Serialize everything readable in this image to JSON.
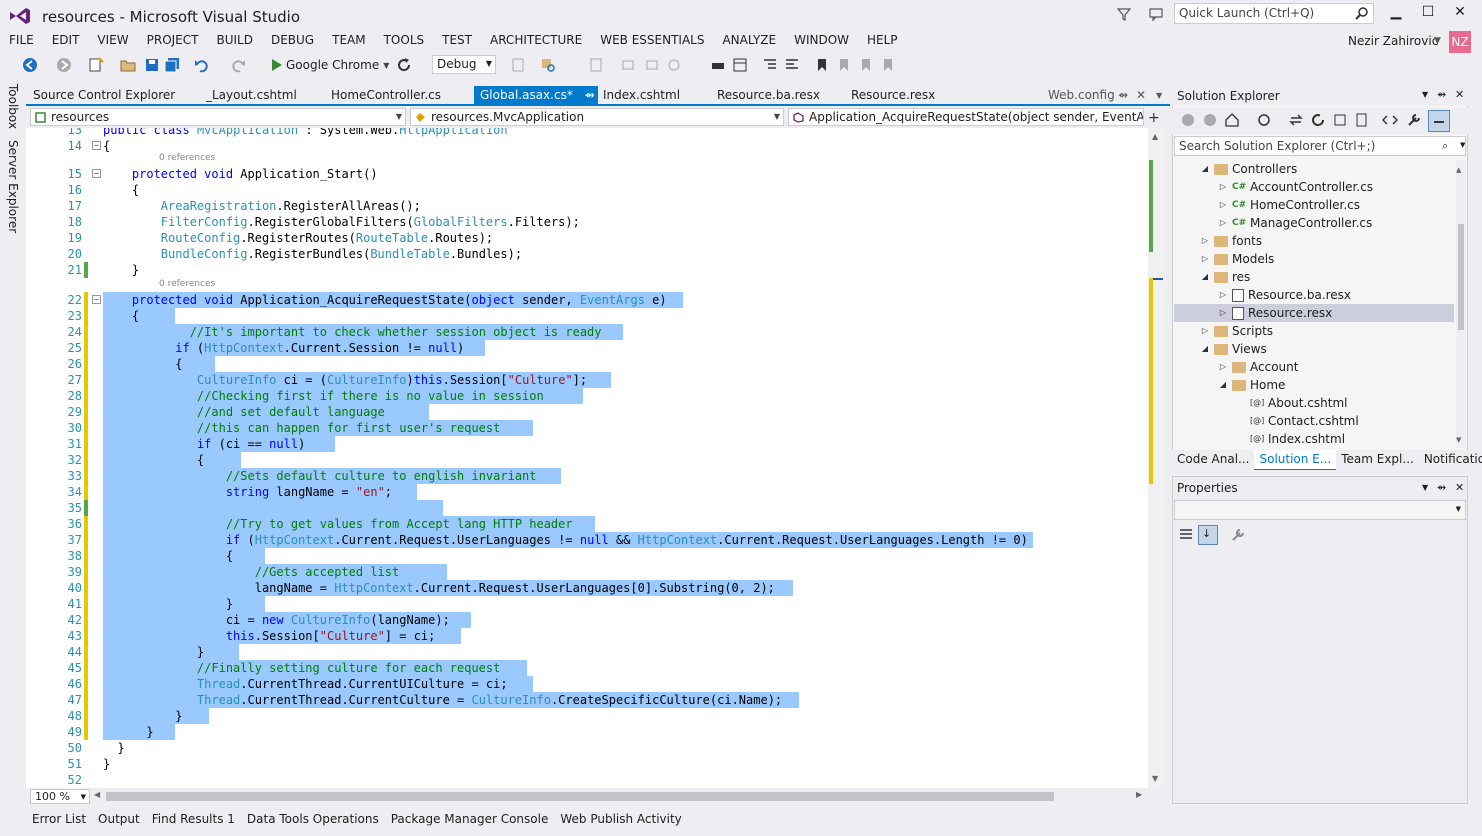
{
  "window": {
    "title": "resources - Microsoft Visual Studio",
    "quick_launch_placeholder": "Quick Launch (Ctrl+Q)",
    "user_name": "Nezir Zahirovic",
    "user_initials": "NZ"
  },
  "menu": [
    "FILE",
    "EDIT",
    "VIEW",
    "PROJECT",
    "BUILD",
    "DEBUG",
    "TEAM",
    "TOOLS",
    "TEST",
    "ARCHITECTURE",
    "WEB ESSENTIALS",
    "ANALYZE",
    "WINDOW",
    "HELP"
  ],
  "toolbar": {
    "run_target": "Google Chrome",
    "configuration": "Debug"
  },
  "side_tabs": [
    "Toolbox",
    "Server Explorer"
  ],
  "doc_tabs": [
    {
      "label": "Source Control Explorer"
    },
    {
      "label": "_Layout.cshtml"
    },
    {
      "label": "HomeController.cs"
    },
    {
      "label": "Global.asax.cs*",
      "active": true
    },
    {
      "label": "Index.cshtml"
    },
    {
      "label": "Resource.ba.resx"
    },
    {
      "label": "Resource.resx"
    },
    {
      "label": "Web.config"
    }
  ],
  "nav": {
    "project": "resources",
    "type": "resources.MvcApplication",
    "member": "Application_AcquireRequestState(object sender, EventArgs e)"
  },
  "editor": {
    "references_label": "0 references",
    "zoom": "100 %",
    "lines": [
      {
        "n": "13",
        "html": "<span class=\"kw\">public</span> <span class=\"kw\">class</span> <span class=\"ty\">MvcApplication</span> : System.Web.<span class=\"ty\">HttpApplication</span>"
      },
      {
        "n": "14",
        "html": "{"
      },
      {
        "n": "15",
        "html": "    <span class=\"kw\">protected</span> <span class=\"kw\">void</span> Application_Start()"
      },
      {
        "n": "16",
        "html": "    {"
      },
      {
        "n": "17",
        "html": "        <span class=\"ty\">AreaRegistration</span>.RegisterAllAreas();"
      },
      {
        "n": "18",
        "html": "        <span class=\"ty\">FilterConfig</span>.RegisterGlobalFilters(<span class=\"ty\">GlobalFilters</span>.Filters);"
      },
      {
        "n": "19",
        "html": "        <span class=\"ty\">RouteConfig</span>.RegisterRoutes(<span class=\"ty\">RouteTable</span>.Routes);"
      },
      {
        "n": "20",
        "html": "        <span class=\"ty\">BundleConfig</span>.RegisterBundles(<span class=\"ty\">BundleTable</span>.Bundles);"
      },
      {
        "n": "21",
        "html": "    }"
      },
      {
        "n": "22",
        "html": "    <span class=\"kw\">protected</span> <span class=\"kw\">void</span> Application_AcquireRequestState(<span class=\"kw\">object</span> sender, <span class=\"ty\">EventArgs</span> e)"
      },
      {
        "n": "23",
        "html": "    {"
      },
      {
        "n": "24",
        "html": "            <span class=\"cm\">//It's important to check whether session object is ready</span>"
      },
      {
        "n": "25",
        "html": "          <span class=\"kw\">if</span> (<span class=\"ty\">HttpContext</span>.Current.Session != <span class=\"kw\">null</span>)"
      },
      {
        "n": "26",
        "html": "          {"
      },
      {
        "n": "27",
        "html": "             <span class=\"ty\">CultureInfo</span> ci = (<span class=\"ty\">CultureInfo</span>)<span class=\"kw\">this</span>.Session[<span class=\"st\">\"Culture\"</span>];"
      },
      {
        "n": "28",
        "html": "             <span class=\"cm\">//Checking first if there is no value in session</span>"
      },
      {
        "n": "29",
        "html": "             <span class=\"cm\">//and set default language</span>"
      },
      {
        "n": "30",
        "html": "             <span class=\"cm\">//this can happen for first user's request</span>"
      },
      {
        "n": "31",
        "html": "             <span class=\"kw\">if</span> (ci == <span class=\"kw\">null</span>)"
      },
      {
        "n": "32",
        "html": "             {"
      },
      {
        "n": "33",
        "html": "                 <span class=\"cm\">//Sets default culture to english invariant</span>"
      },
      {
        "n": "34",
        "html": "                 <span class=\"kw\">string</span> langName = <span class=\"st\">\"en\"</span>;"
      },
      {
        "n": "35",
        "html": ""
      },
      {
        "n": "36",
        "html": "                 <span class=\"cm\">//Try to get values from Accept lang HTTP header</span>"
      },
      {
        "n": "37",
        "html": "                 <span class=\"kw\">if</span> (<span class=\"ty\">HttpContext</span>.Current.Request.UserLanguages != <span class=\"kw\">null</span> &amp;&amp; <span class=\"ty\">HttpContext</span>.Current.Request.UserLanguages.Length != 0)"
      },
      {
        "n": "38",
        "html": "                 {"
      },
      {
        "n": "39",
        "html": "                     <span class=\"cm\">//Gets accepted list</span>"
      },
      {
        "n": "40",
        "html": "                     langName = <span class=\"ty\">HttpContext</span>.Current.Request.UserLanguages[0].Substring(0, 2);"
      },
      {
        "n": "41",
        "html": "                 }"
      },
      {
        "n": "42",
        "html": "                 ci = <span class=\"kw\">new</span> <span class=\"ty\">CultureInfo</span>(langName);"
      },
      {
        "n": "43",
        "html": "                 <span class=\"kw\">this</span>.Session[<span class=\"st\">\"Culture\"</span>] = ci;"
      },
      {
        "n": "44",
        "html": "             }"
      },
      {
        "n": "45",
        "html": "             <span class=\"cm\">//Finally setting culture for each request</span>"
      },
      {
        "n": "46",
        "html": "             <span class=\"ty\">Thread</span>.CurrentThread.CurrentUICulture = ci;"
      },
      {
        "n": "47",
        "html": "             <span class=\"ty\">Thread</span>.CurrentThread.CurrentCulture = <span class=\"ty\">CultureInfo</span>.CreateSpecificCulture(ci.Name);"
      },
      {
        "n": "48",
        "html": "          }"
      },
      {
        "n": "49",
        "html": "      }"
      },
      {
        "n": "50",
        "html": "  }"
      },
      {
        "n": "51",
        "html": "}"
      },
      {
        "n": "52",
        "html": ""
      }
    ]
  },
  "bottom_tabs": [
    "Error List",
    "Output",
    "Find Results 1",
    "Data Tools Operations",
    "Package Manager Console",
    "Web Publish Activity"
  ],
  "solution_explorer": {
    "title": "Solution Explorer",
    "search_placeholder": "Search Solution Explorer (Ctrl+;)",
    "tree": [
      {
        "label": "Controllers",
        "icon": "folder",
        "expanded": true
      },
      {
        "label": "AccountController.cs",
        "icon": "cs"
      },
      {
        "label": "HomeController.cs",
        "icon": "cs"
      },
      {
        "label": "ManageController.cs",
        "icon": "cs"
      },
      {
        "label": "fonts",
        "icon": "folder"
      },
      {
        "label": "Models",
        "icon": "folder"
      },
      {
        "label": "res",
        "icon": "folder",
        "expanded": true
      },
      {
        "label": "Resource.ba.resx",
        "icon": "resx"
      },
      {
        "label": "Resource.resx",
        "icon": "resx",
        "selected": true
      },
      {
        "label": "Scripts",
        "icon": "folder"
      },
      {
        "label": "Views",
        "icon": "folder",
        "expanded": true
      },
      {
        "label": "Account",
        "icon": "folder"
      },
      {
        "label": "Home",
        "icon": "folder",
        "expanded": true
      },
      {
        "label": "About.cshtml",
        "icon": "cshtml"
      },
      {
        "label": "Contact.cshtml",
        "icon": "cshtml"
      },
      {
        "label": "Index.cshtml",
        "icon": "cshtml"
      }
    ],
    "tabs": [
      {
        "label": "Code Anal..."
      },
      {
        "label": "Solution E...",
        "active": true
      },
      {
        "label": "Team Expl..."
      },
      {
        "label": "Notificatio..."
      }
    ]
  },
  "properties": {
    "title": "Properties"
  },
  "colors": {
    "accent": "#007acc",
    "selection": "#99c9ff",
    "keyword": "#0000ff",
    "type": "#2b91af",
    "comment": "#008000",
    "string": "#a31515"
  }
}
